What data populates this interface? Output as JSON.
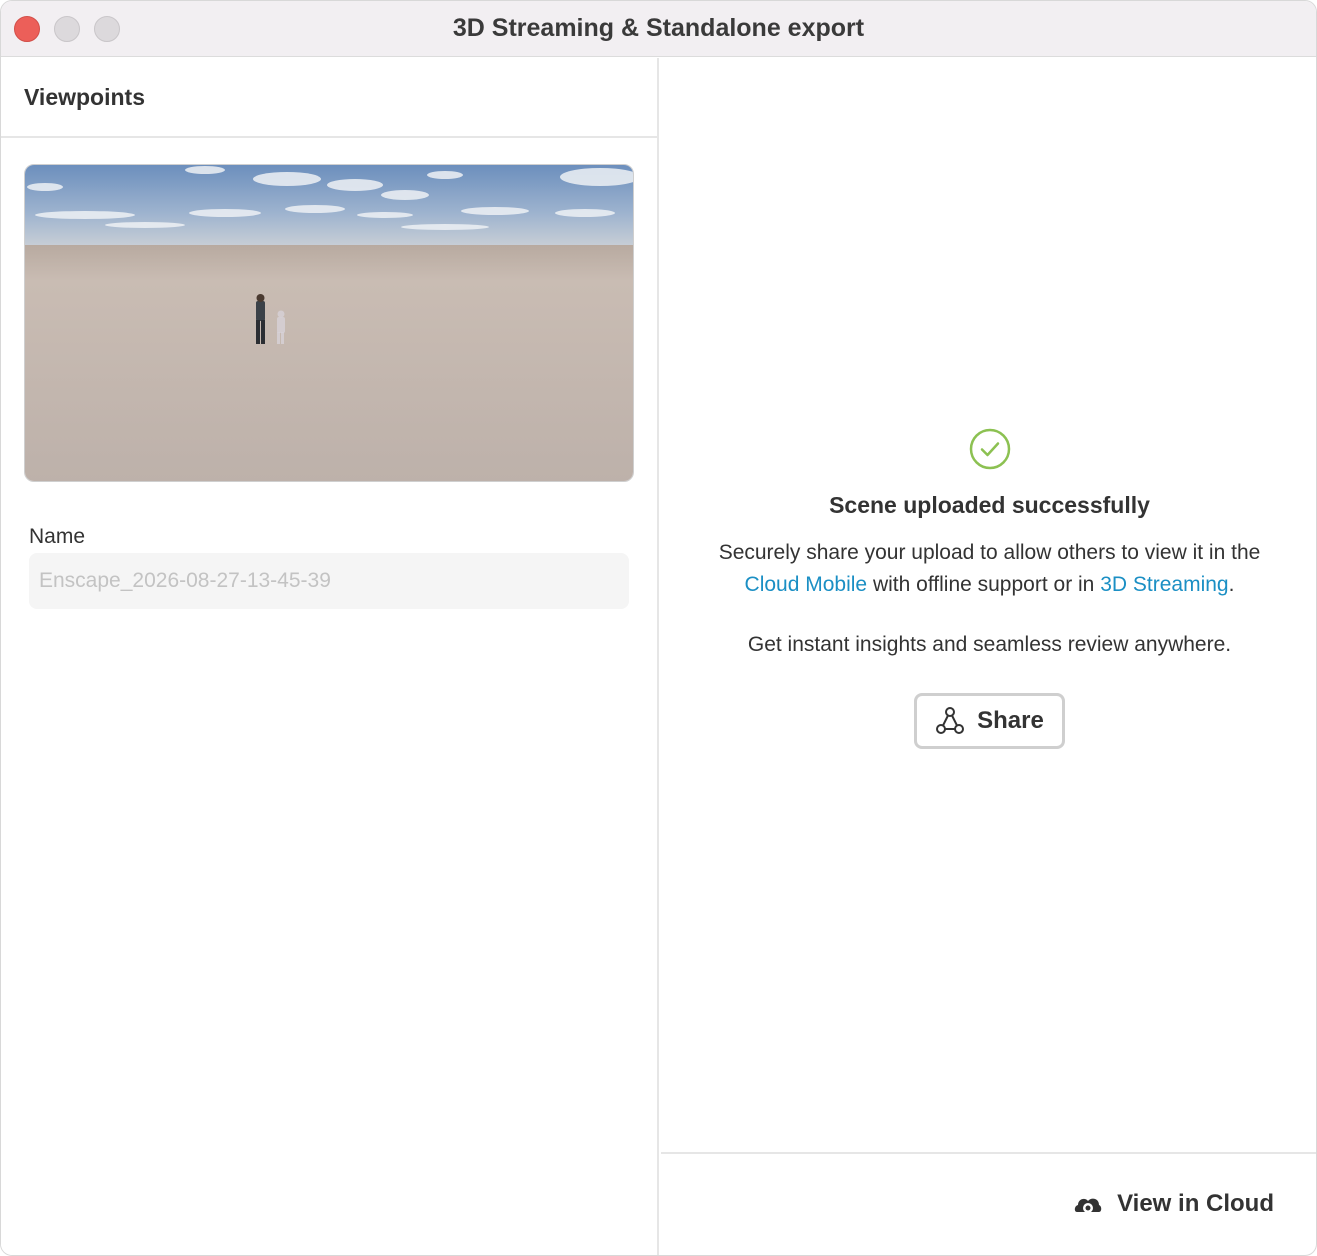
{
  "window": {
    "title": "3D Streaming & Standalone export"
  },
  "left_panel": {
    "heading": "Viewpoints",
    "name_label": "Name",
    "name_placeholder": "Enscape_2026-08-27-13-45-39"
  },
  "right_panel": {
    "success_title": "Scene uploaded successfully",
    "desc_part1": "Securely share your upload to allow others to view it in the ",
    "link_cloud_mobile": "Cloud Mobile",
    "desc_part2": " with offline support or in ",
    "link_3d_streaming": "3D Streaming",
    "desc_part3": ".",
    "desc_second": "Get instant insights and seamless review anywhere.",
    "share_label": "Share"
  },
  "footer": {
    "view_in_cloud_label": "View in Cloud"
  },
  "colors": {
    "accent_link": "#1b8fc4",
    "success_green": "#8cc152",
    "close_red": "#ec5f59"
  }
}
